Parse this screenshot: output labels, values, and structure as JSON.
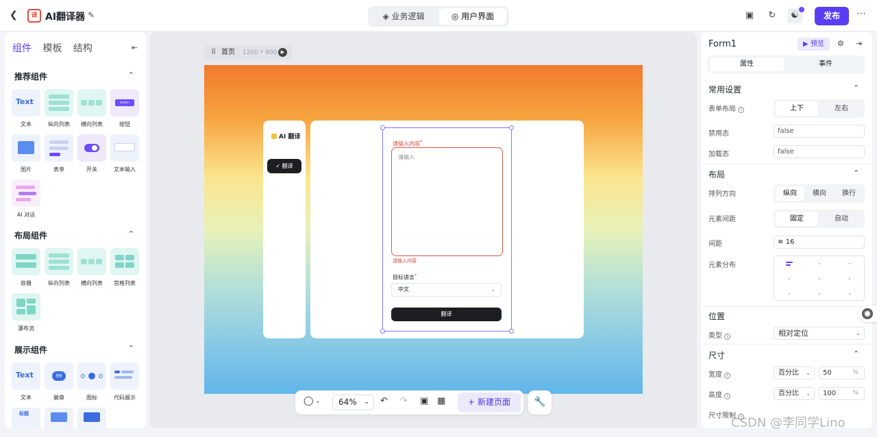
{
  "topbar": {
    "app_title": "AI翻译器",
    "mode_tabs": [
      {
        "label": "业务逻辑"
      },
      {
        "label": "用户界面"
      }
    ],
    "publish_label": "发布"
  },
  "left_panel": {
    "tabs": [
      "组件",
      "模板",
      "结构"
    ],
    "sections": [
      {
        "title": "推荐组件",
        "items": [
          "文本",
          "纵向列表",
          "横向列表",
          "按钮",
          "图片",
          "表单",
          "开关",
          "文本输入",
          "AI 对话"
        ]
      },
      {
        "title": "布局组件",
        "items": [
          "容器",
          "纵向列表",
          "横向列表",
          "宫格列表",
          "瀑布流"
        ]
      },
      {
        "title": "展示组件",
        "items": [
          "文本",
          "徽章",
          "图标",
          "代码展示"
        ]
      }
    ],
    "tile_text_sample": "Text",
    "tile_button_sample": "Button",
    "tile_badge_sample": "99",
    "tile_label_sample": "标题"
  },
  "canvas": {
    "page_name": "首页",
    "page_dims": "1200 * 900",
    "nav_title": "AI 翻译",
    "nav_button": "翻译",
    "form": {
      "input_label": "请输入内容",
      "input_placeholder": "请输入",
      "error_text": "请输入内容",
      "lang_label": "目标语言",
      "lang_value": "中文",
      "submit_label": "翻译"
    },
    "required_mark": "*"
  },
  "bottom_toolbar": {
    "zoom": "64%",
    "new_page_label": "新建页面"
  },
  "right_panel": {
    "component_name": "Form1",
    "preview_label": "预览",
    "tabs": [
      "属性",
      "事件"
    ],
    "common": {
      "title": "常用设置",
      "layout_label": "表单布局",
      "layout_options": [
        "上下",
        "左右"
      ],
      "disabled_label": "禁用态",
      "disabled_value": "false",
      "loading_label": "加载态",
      "loading_value": "false"
    },
    "layout": {
      "title": "布局",
      "direction_label": "排列方向",
      "direction_options": [
        "纵向",
        "横向",
        "换行"
      ],
      "spacing_label": "元素间距",
      "spacing_options": [
        "固定",
        "自动"
      ],
      "gap_label": "间距",
      "gap_value": "16",
      "distribution_label": "元素分布"
    },
    "position": {
      "title": "位置",
      "type_label": "类型",
      "type_value": "相对定位"
    },
    "size": {
      "title": "尺寸",
      "width_label": "宽度",
      "width_mode": "百分比",
      "width_value": "50",
      "height_label": "高度",
      "height_mode": "百分比",
      "height_value": "100",
      "unit": "%",
      "limit_label": "尺寸限制"
    }
  },
  "watermark": "CSDN @李同学Lino",
  "colors": {
    "accent": "#5b3df5",
    "error": "#d64531",
    "dark_button": "#1d1e22"
  }
}
